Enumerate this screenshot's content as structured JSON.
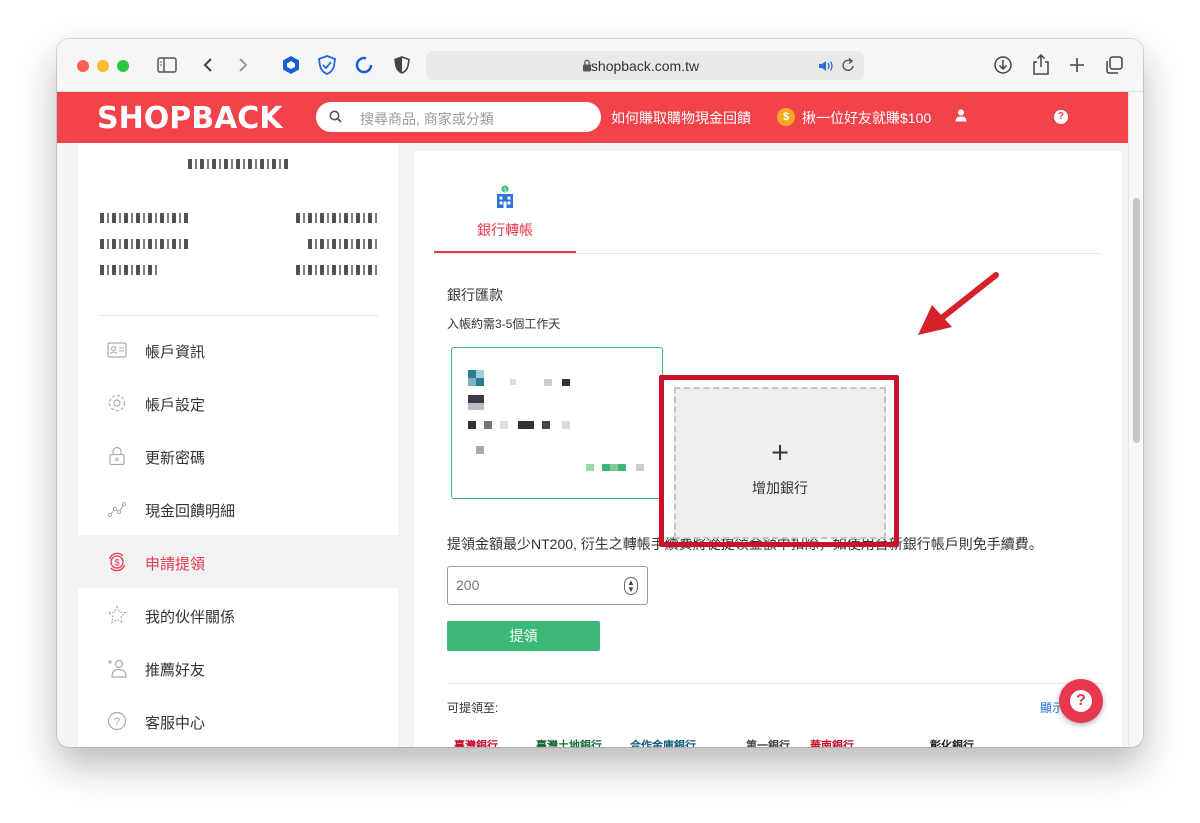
{
  "browser": {
    "url": "shopback.com.tw"
  },
  "header": {
    "logo": "SHOPBACK",
    "search_placeholder": "搜尋商品, 商家或分類",
    "how_to_earn": "如何賺取購物現金回饋",
    "coin_symbol": "$",
    "referral": "揪一位好友就賺$100",
    "help_symbol": "?"
  },
  "sidebar": {
    "items": [
      {
        "label": "帳戶資訊",
        "icon": "id-card-icon"
      },
      {
        "label": "帳戶設定",
        "icon": "gear-icon"
      },
      {
        "label": "更新密碼",
        "icon": "lock-icon"
      },
      {
        "label": "現金回饋明細",
        "icon": "trend-icon"
      },
      {
        "label": "申請提領",
        "icon": "cash-withdraw-icon"
      },
      {
        "label": "我的伙伴關係",
        "icon": "star-icon"
      },
      {
        "label": "推薦好友",
        "icon": "add-user-icon"
      },
      {
        "label": "客服中心",
        "icon": "question-icon"
      }
    ]
  },
  "main": {
    "tab_label": "銀行轉帳",
    "section_title": "銀行匯款",
    "section_sub": "入帳約需3-5個工作天",
    "add_bank_symbol": "+",
    "add_bank_label": "增加銀行",
    "note": "提領金額最少NT200, 衍生之轉帳手續費將從提領金額中扣除，如使用台新銀行帳戶則免手續費。",
    "amount_placeholder": "200",
    "withdraw_label": "提領",
    "can_withdraw_to": "可提領至:",
    "show_more": "顯示"
  },
  "banks": [
    {
      "label": "臺灣銀行",
      "color": "#c8102e"
    },
    {
      "label": "臺灣土地銀行",
      "color": "#1b6b3a"
    },
    {
      "label": "合作金庫銀行",
      "color": "#0f5b7a"
    },
    {
      "label": "第一銀行",
      "color": "#444444"
    },
    {
      "label": "華南銀行",
      "color": "#c8102e"
    },
    {
      "label": "彰化銀行",
      "color": "#222222"
    }
  ],
  "colors": {
    "brand": "#f2424a",
    "accent": "#e8384f",
    "success": "#3cb878",
    "highlight": "#c9122a"
  },
  "fab_symbol": "?"
}
